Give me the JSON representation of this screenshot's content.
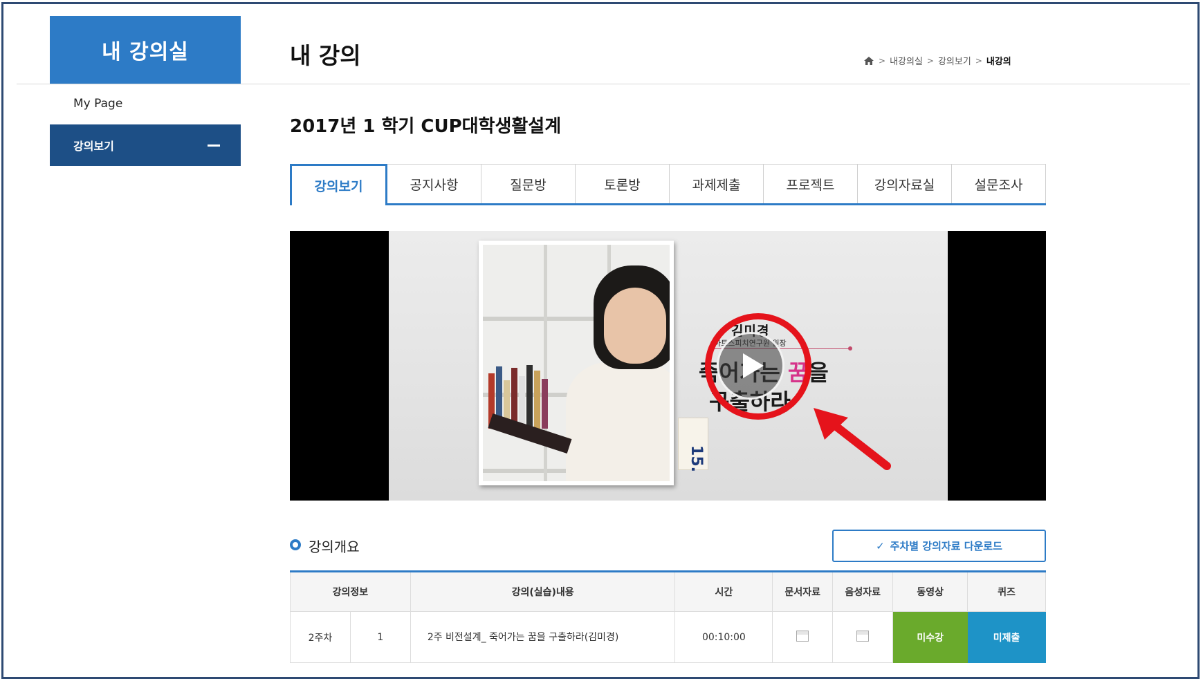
{
  "sidebar": {
    "title": "내 강의실",
    "my_page": "My Page",
    "active_item": "강의보기"
  },
  "header": {
    "title": "내 강의",
    "breadcrumb": [
      "내강의실",
      "강의보기",
      "내강의"
    ]
  },
  "course": {
    "title": "2017년 1 학기 CUP대학생활설계"
  },
  "tabs": [
    "강의보기",
    "공지사항",
    "질문방",
    "토론방",
    "과제제출",
    "프로젝트",
    "강의자료실",
    "설문조사"
  ],
  "video": {
    "speaker_name": "김미경",
    "speaker_role": "아트스피치연구원 원장",
    "headline_part1": "죽어가는 ",
    "headline_highlight": "꿈",
    "headline_part2": "을",
    "headline_line2": "구출하라",
    "badge": "15."
  },
  "overview": {
    "title": "강의개요",
    "download_label": "주차별 강의자료 다운로드"
  },
  "table": {
    "headers": [
      "강의정보",
      "강의(실습)내용",
      "시간",
      "문서자료",
      "음성자료",
      "동영상",
      "퀴즈"
    ],
    "rows": [
      {
        "week": "2주차",
        "number": "1",
        "content": "2주 비전설계_ 죽어가는 꿈을 구출하라(김미경)",
        "time": "00:10:00",
        "video_status": "미수강",
        "quiz_status": "미제출"
      }
    ]
  },
  "colors": {
    "primary": "#2d7bc6",
    "sidebar_active": "#1d4f86",
    "video_status": "#6aaa2c",
    "quiz_status": "#1e93c7",
    "annotation": "#e5131b"
  }
}
